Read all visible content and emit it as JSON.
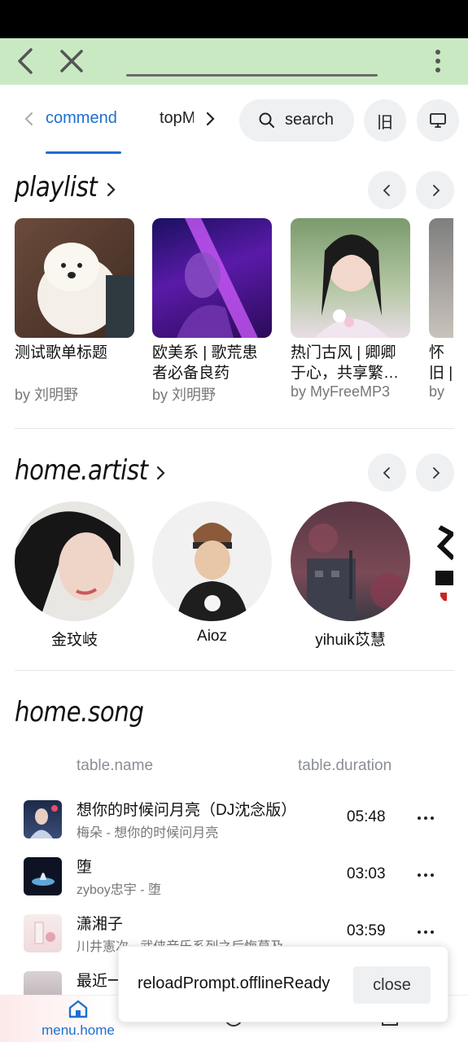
{
  "browser": {
    "back_icon": "chevron-left-icon",
    "close_icon": "close-icon",
    "menu_icon": "more-vertical-icon"
  },
  "topnav": {
    "tabs": [
      {
        "label": "commend"
      },
      {
        "label": "topMV"
      }
    ],
    "search_label": "search",
    "lang_label": "旧",
    "desktop_icon": "monitor-icon"
  },
  "playlist": {
    "title": "playlist",
    "items": [
      {
        "title": "测试歌单标题",
        "by": "by 刘明野"
      },
      {
        "title": "欧美系 | 歌荒患者必备良药",
        "by": "by 刘明野"
      },
      {
        "title": "热门古风 | 卿卿于心，共享繁…",
        "by": "by MyFreeMP3"
      },
      {
        "title": "怀旧 | 时",
        "by": "by"
      }
    ]
  },
  "artists": {
    "title": "home.artist",
    "items": [
      {
        "name": "金玟岐"
      },
      {
        "name": "Aioz"
      },
      {
        "name": "yihuik苡慧"
      }
    ]
  },
  "songs": {
    "title": "home.song",
    "col_name": "table.name",
    "col_duration": "table.duration",
    "rows": [
      {
        "name": "想你的时候问月亮（DJ沈念版）",
        "sub": "梅朵 - 想你的时候问月亮",
        "duration": "05:48"
      },
      {
        "name": "堕",
        "sub": "zyboy忠宇 - 堕",
        "duration": "03:03"
      },
      {
        "name": "潇湘子",
        "sub": "川井憲次 - 武侠音乐系列之后悔莫及",
        "duration": "03:59"
      },
      {
        "name": "最近一",
        "sub": "",
        "duration": ""
      }
    ]
  },
  "bottomnav": {
    "home_label": "menu.home"
  },
  "toast": {
    "message": "reloadPrompt.offlineReady",
    "close_label": "close"
  },
  "colors": {
    "accent": "#1e6fcf",
    "browser_bar": "#c9e9c3",
    "pill_bg": "#eef0f2"
  }
}
